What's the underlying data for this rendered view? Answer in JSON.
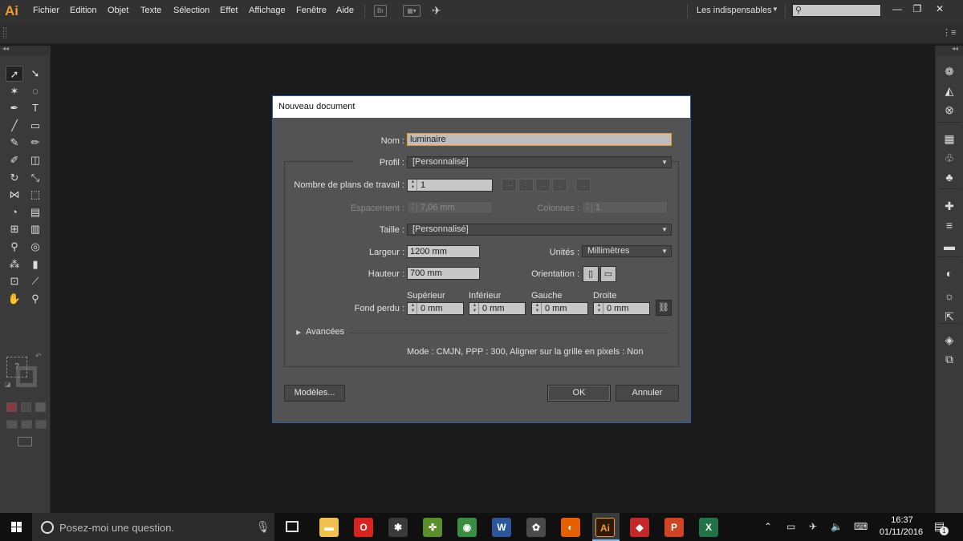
{
  "app": {
    "logo": "Ai"
  },
  "menu": [
    "Fichier",
    "Edition",
    "Objet",
    "Texte",
    "Sélection",
    "Effet",
    "Affichage",
    "Fenêtre",
    "Aide"
  ],
  "toolbar_icons": [
    "bridge-icon",
    "arrange-documents-icon",
    "gpu-performance-icon"
  ],
  "workspace": {
    "label": "Les indispensables"
  },
  "search": {
    "placeholder": "",
    "icon": "search-icon"
  },
  "window_controls": {
    "minimize": "—",
    "restore": "❐",
    "close": "✕"
  },
  "tools": [
    {
      "name": "selection-tool",
      "glyph": "➚",
      "selected": true
    },
    {
      "name": "direct-selection-tool",
      "glyph": "➘"
    },
    {
      "name": "magic-wand-tool",
      "glyph": "✶"
    },
    {
      "name": "lasso-tool",
      "glyph": "◌"
    },
    {
      "name": "pen-tool",
      "glyph": "✒"
    },
    {
      "name": "type-tool",
      "glyph": "T"
    },
    {
      "name": "line-segment-tool",
      "glyph": "╱"
    },
    {
      "name": "rectangle-tool",
      "glyph": "▭"
    },
    {
      "name": "paintbrush-tool",
      "glyph": "✎"
    },
    {
      "name": "pencil-tool",
      "glyph": "✏"
    },
    {
      "name": "blob-brush-tool",
      "glyph": "✐"
    },
    {
      "name": "eraser-tool",
      "glyph": "◫"
    },
    {
      "name": "rotate-tool",
      "glyph": "↻"
    },
    {
      "name": "scale-tool",
      "glyph": "⤡"
    },
    {
      "name": "width-tool",
      "glyph": "⋈"
    },
    {
      "name": "free-transform-tool",
      "glyph": "⬚"
    },
    {
      "name": "shape-builder-tool",
      "glyph": "◔"
    },
    {
      "name": "chart-tool",
      "glyph": "▤"
    },
    {
      "name": "mesh-tool",
      "glyph": "⊞"
    },
    {
      "name": "gradient-tool",
      "glyph": "▥"
    },
    {
      "name": "eyedropper-tool",
      "glyph": "⚲"
    },
    {
      "name": "blend-tool",
      "glyph": "◎"
    },
    {
      "name": "symbol-sprayer-tool",
      "glyph": "⁂"
    },
    {
      "name": "column-graph-tool",
      "glyph": "▮"
    },
    {
      "name": "artboard-tool",
      "glyph": "⊡"
    },
    {
      "name": "slice-tool",
      "glyph": "⟋"
    },
    {
      "name": "hand-tool",
      "glyph": "✋"
    },
    {
      "name": "zoom-tool",
      "glyph": "⚲"
    }
  ],
  "fill_label": "?",
  "right_panel": [
    "color-icon",
    "color-guide-icon",
    "brushes-icon",
    "symbols-icon",
    "swatches-icon",
    "graphic-styles-icon",
    "libraries-icon",
    "stroke-icon",
    "gradient-icon",
    "transparency-icon",
    "appearance-icon",
    "export-icon",
    "layers-icon",
    "artboards-icon"
  ],
  "dialog": {
    "title": "Nouveau document",
    "name_label": "Nom :",
    "name_value": "luminaire",
    "profile_label": "Profil :",
    "profile_value": "[Personnalisé]",
    "artboards_label": "Nombre de plans de travail :",
    "artboards_value": "1",
    "spacing_label": "Espacement :",
    "spacing_value": "7,06 mm",
    "columns_label": "Colonnes :",
    "columns_value": "1",
    "size_label": "Taille :",
    "size_value": "[Personnalisé]",
    "width_label": "Largeur :",
    "width_value": "1200 mm",
    "units_label": "Unités :",
    "units_value": "Millimètres",
    "height_label": "Hauteur :",
    "height_value": "700 mm",
    "orientation_label": "Orientation :",
    "bleed_label": "Fond perdu :",
    "bleed": [
      {
        "label": "Supérieur",
        "value": "0 mm"
      },
      {
        "label": "Inférieur",
        "value": "0 mm"
      },
      {
        "label": "Gauche",
        "value": "0 mm"
      },
      {
        "label": "Droite",
        "value": "0 mm"
      }
    ],
    "advanced_label": "Avancées",
    "summary": "Mode : CMJN, PPP : 300, Aligner sur la grille en pixels : Non",
    "templates_button": "Modèles...",
    "ok_button": "OK",
    "cancel_button": "Annuler"
  },
  "taskbar": {
    "search_placeholder": "Posez-moi une question.",
    "apps": [
      {
        "name": "file-explorer",
        "color": "#f0c24b",
        "glyph": "▬"
      },
      {
        "name": "opera",
        "color": "#d9231f",
        "glyph": "O"
      },
      {
        "name": "app-3",
        "color": "#3a3a3a",
        "glyph": "✱"
      },
      {
        "name": "app-4",
        "color": "#5a8e2b",
        "glyph": "✜"
      },
      {
        "name": "chrome",
        "color": "#3b8d3f",
        "glyph": "◉"
      },
      {
        "name": "word",
        "color": "#2b579a",
        "glyph": "W"
      },
      {
        "name": "app-7",
        "color": "#4a4a4a",
        "glyph": "✿"
      },
      {
        "name": "firefox",
        "color": "#e66000",
        "glyph": "◐"
      },
      {
        "name": "illustrator",
        "color": "#2c1a04",
        "glyph": "Ai",
        "active": true
      },
      {
        "name": "app-10",
        "color": "#c62828",
        "glyph": "◆"
      },
      {
        "name": "powerpoint",
        "color": "#d04423",
        "glyph": "P"
      },
      {
        "name": "excel",
        "color": "#217346",
        "glyph": "X"
      }
    ],
    "time": "16:37",
    "date": "01/11/2016",
    "notifications": "1"
  }
}
